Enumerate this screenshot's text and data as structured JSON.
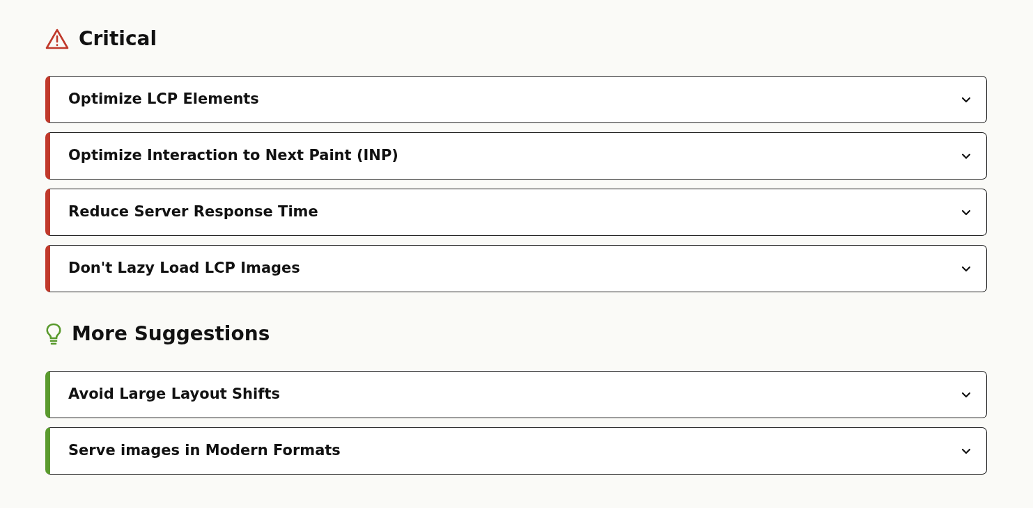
{
  "sections": [
    {
      "kind": "critical",
      "title": "Critical",
      "color": "#c0392b",
      "items": [
        {
          "label": "Optimize LCP Elements",
          "expanded": false
        },
        {
          "label": "Optimize Interaction to Next Paint (INP)",
          "expanded": false
        },
        {
          "label": "Reduce Server Response Time",
          "expanded": false
        },
        {
          "label": "Don't Lazy Load LCP Images",
          "expanded": false
        }
      ]
    },
    {
      "kind": "suggestion",
      "title": "More Suggestions",
      "color": "#5a9a2e",
      "items": [
        {
          "label": "Avoid Large Layout Shifts",
          "expanded": false
        },
        {
          "label": "Serve images in Modern Formats",
          "expanded": false
        }
      ]
    }
  ]
}
